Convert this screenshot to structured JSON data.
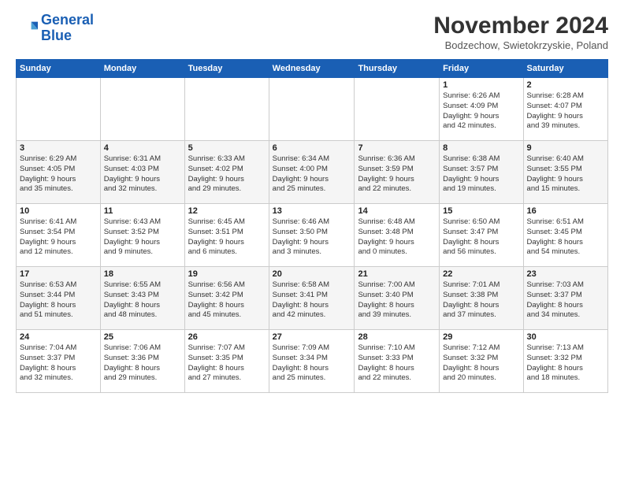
{
  "logo": {
    "text1": "General",
    "text2": "Blue"
  },
  "header": {
    "month": "November 2024",
    "location": "Bodzechow, Swietokrzyskie, Poland"
  },
  "weekdays": [
    "Sunday",
    "Monday",
    "Tuesday",
    "Wednesday",
    "Thursday",
    "Friday",
    "Saturday"
  ],
  "weeks": [
    [
      {
        "day": "",
        "info": ""
      },
      {
        "day": "",
        "info": ""
      },
      {
        "day": "",
        "info": ""
      },
      {
        "day": "",
        "info": ""
      },
      {
        "day": "",
        "info": ""
      },
      {
        "day": "1",
        "info": "Sunrise: 6:26 AM\nSunset: 4:09 PM\nDaylight: 9 hours\nand 42 minutes."
      },
      {
        "day": "2",
        "info": "Sunrise: 6:28 AM\nSunset: 4:07 PM\nDaylight: 9 hours\nand 39 minutes."
      }
    ],
    [
      {
        "day": "3",
        "info": "Sunrise: 6:29 AM\nSunset: 4:05 PM\nDaylight: 9 hours\nand 35 minutes."
      },
      {
        "day": "4",
        "info": "Sunrise: 6:31 AM\nSunset: 4:03 PM\nDaylight: 9 hours\nand 32 minutes."
      },
      {
        "day": "5",
        "info": "Sunrise: 6:33 AM\nSunset: 4:02 PM\nDaylight: 9 hours\nand 29 minutes."
      },
      {
        "day": "6",
        "info": "Sunrise: 6:34 AM\nSunset: 4:00 PM\nDaylight: 9 hours\nand 25 minutes."
      },
      {
        "day": "7",
        "info": "Sunrise: 6:36 AM\nSunset: 3:59 PM\nDaylight: 9 hours\nand 22 minutes."
      },
      {
        "day": "8",
        "info": "Sunrise: 6:38 AM\nSunset: 3:57 PM\nDaylight: 9 hours\nand 19 minutes."
      },
      {
        "day": "9",
        "info": "Sunrise: 6:40 AM\nSunset: 3:55 PM\nDaylight: 9 hours\nand 15 minutes."
      }
    ],
    [
      {
        "day": "10",
        "info": "Sunrise: 6:41 AM\nSunset: 3:54 PM\nDaylight: 9 hours\nand 12 minutes."
      },
      {
        "day": "11",
        "info": "Sunrise: 6:43 AM\nSunset: 3:52 PM\nDaylight: 9 hours\nand 9 minutes."
      },
      {
        "day": "12",
        "info": "Sunrise: 6:45 AM\nSunset: 3:51 PM\nDaylight: 9 hours\nand 6 minutes."
      },
      {
        "day": "13",
        "info": "Sunrise: 6:46 AM\nSunset: 3:50 PM\nDaylight: 9 hours\nand 3 minutes."
      },
      {
        "day": "14",
        "info": "Sunrise: 6:48 AM\nSunset: 3:48 PM\nDaylight: 9 hours\nand 0 minutes."
      },
      {
        "day": "15",
        "info": "Sunrise: 6:50 AM\nSunset: 3:47 PM\nDaylight: 8 hours\nand 56 minutes."
      },
      {
        "day": "16",
        "info": "Sunrise: 6:51 AM\nSunset: 3:45 PM\nDaylight: 8 hours\nand 54 minutes."
      }
    ],
    [
      {
        "day": "17",
        "info": "Sunrise: 6:53 AM\nSunset: 3:44 PM\nDaylight: 8 hours\nand 51 minutes."
      },
      {
        "day": "18",
        "info": "Sunrise: 6:55 AM\nSunset: 3:43 PM\nDaylight: 8 hours\nand 48 minutes."
      },
      {
        "day": "19",
        "info": "Sunrise: 6:56 AM\nSunset: 3:42 PM\nDaylight: 8 hours\nand 45 minutes."
      },
      {
        "day": "20",
        "info": "Sunrise: 6:58 AM\nSunset: 3:41 PM\nDaylight: 8 hours\nand 42 minutes."
      },
      {
        "day": "21",
        "info": "Sunrise: 7:00 AM\nSunset: 3:40 PM\nDaylight: 8 hours\nand 39 minutes."
      },
      {
        "day": "22",
        "info": "Sunrise: 7:01 AM\nSunset: 3:38 PM\nDaylight: 8 hours\nand 37 minutes."
      },
      {
        "day": "23",
        "info": "Sunrise: 7:03 AM\nSunset: 3:37 PM\nDaylight: 8 hours\nand 34 minutes."
      }
    ],
    [
      {
        "day": "24",
        "info": "Sunrise: 7:04 AM\nSunset: 3:37 PM\nDaylight: 8 hours\nand 32 minutes."
      },
      {
        "day": "25",
        "info": "Sunrise: 7:06 AM\nSunset: 3:36 PM\nDaylight: 8 hours\nand 29 minutes."
      },
      {
        "day": "26",
        "info": "Sunrise: 7:07 AM\nSunset: 3:35 PM\nDaylight: 8 hours\nand 27 minutes."
      },
      {
        "day": "27",
        "info": "Sunrise: 7:09 AM\nSunset: 3:34 PM\nDaylight: 8 hours\nand 25 minutes."
      },
      {
        "day": "28",
        "info": "Sunrise: 7:10 AM\nSunset: 3:33 PM\nDaylight: 8 hours\nand 22 minutes."
      },
      {
        "day": "29",
        "info": "Sunrise: 7:12 AM\nSunset: 3:32 PM\nDaylight: 8 hours\nand 20 minutes."
      },
      {
        "day": "30",
        "info": "Sunrise: 7:13 AM\nSunset: 3:32 PM\nDaylight: 8 hours\nand 18 minutes."
      }
    ]
  ]
}
